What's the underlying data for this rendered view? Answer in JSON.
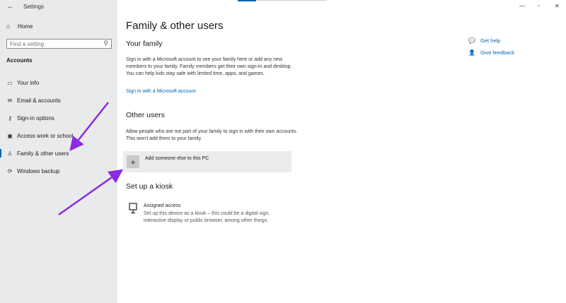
{
  "window": {
    "app_title": "Settings",
    "back_glyph": "←",
    "minimize_glyph": "—",
    "maximize_glyph": "▫",
    "close_glyph": "✕"
  },
  "sidebar": {
    "home_label": "Home",
    "search_placeholder": "Find a setting",
    "section_title": "Accounts",
    "items": [
      {
        "label": "Your info",
        "icon": "person-card-icon"
      },
      {
        "label": "Email & accounts",
        "icon": "mail-icon"
      },
      {
        "label": "Sign-in options",
        "icon": "key-icon"
      },
      {
        "label": "Access work or school",
        "icon": "briefcase-icon"
      },
      {
        "label": "Family & other users",
        "icon": "person-add-icon",
        "active": true
      },
      {
        "label": "Windows backup",
        "icon": "sync-icon"
      }
    ]
  },
  "main": {
    "title": "Family & other users",
    "your_family": {
      "heading": "Your family",
      "description": "Sign in with a Microsoft account to see your family here or add any new members to your family. Family members get their own sign-in and desktop. You can help kids stay safe with limited time, apps, and games.",
      "link": "Sign in with a Microsoft account"
    },
    "other_users": {
      "heading": "Other users",
      "description": "Allow people who are not part of your family to sign in with their own accounts. This won't add them to your family.",
      "add_label": "Add someone else to this PC"
    },
    "kiosk": {
      "heading": "Set up a kiosk",
      "title": "Assigned access",
      "description": "Set up this device as a kiosk – this could be a digital sign, interactive display or public browser, among other things."
    }
  },
  "right_panel": {
    "get_help": "Get help",
    "give_feedback": "Give feedback"
  },
  "colors": {
    "accent": "#0067b8",
    "sidebar_bg": "#e9eaec",
    "annotation_arrow": "#8a2be2"
  }
}
